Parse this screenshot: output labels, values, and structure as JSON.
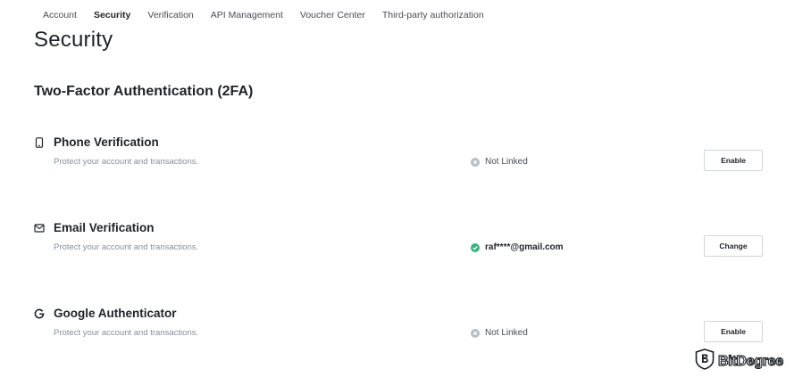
{
  "nav": {
    "tabs": [
      {
        "label": "Account"
      },
      {
        "label": "Security",
        "active": true
      },
      {
        "label": "Verification"
      },
      {
        "label": "API Management"
      },
      {
        "label": "Voucher Center"
      },
      {
        "label": "Third-party authorization"
      }
    ]
  },
  "page_title": "Security",
  "section_title": "Two-Factor Authentication (2FA)",
  "methods": [
    {
      "icon": "phone-icon",
      "label": "Phone Verification",
      "description": "Protect your account and transactions.",
      "status_icon": "not-linked-icon",
      "status_text": "Not Linked",
      "button_label": "Enable"
    },
    {
      "icon": "mail-icon",
      "label": "Email Verification",
      "description": "Protect your account and transactions.",
      "status_icon": "check-icon",
      "status_text": "raf****@gmail.com",
      "button_label": "Change"
    },
    {
      "icon": "google-icon",
      "label": "Google Authenticator",
      "description": "Protect your account and transactions.",
      "status_icon": "not-linked-icon",
      "status_text": "Not Linked",
      "button_label": "Enable"
    }
  ],
  "watermark": {
    "text": "BitDegree",
    "icon": "bitdegree-logo-icon"
  },
  "colors": {
    "success": "#2eb67d",
    "muted_icon": "#b7bdc6",
    "text_primary": "#1e2329",
    "text_secondary": "#848e9c"
  }
}
